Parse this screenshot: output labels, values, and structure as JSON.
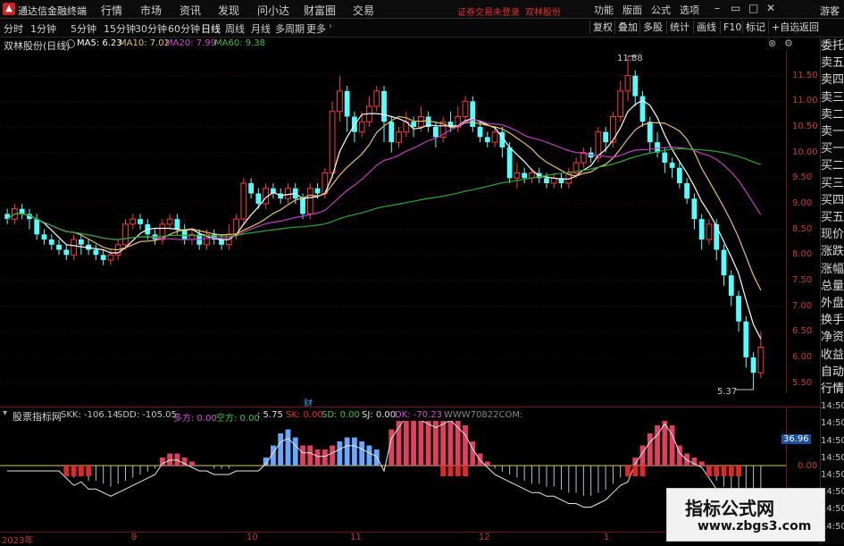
{
  "app": {
    "title": "通达信金融终端",
    "menus": [
      "行情",
      "市场",
      "资讯",
      "发现",
      "问小达",
      "财富圈",
      "交易"
    ],
    "notice": "证券交易未登录",
    "stock_name_top": "双林股份",
    "right_menus": [
      "功能",
      "版面",
      "公式",
      "选项"
    ],
    "guest": "游客"
  },
  "toolbar": {
    "periods": [
      "分时",
      "1分钟",
      "5分钟",
      "15分钟",
      "30分钟",
      "60分钟",
      "日线",
      "周线",
      "月线",
      "多周期",
      "更多"
    ],
    "active_period": "日线",
    "right_buttons": [
      "复权",
      "叠加",
      "多股",
      "统计",
      "画线",
      "F10",
      "标记",
      "+自选",
      "返回"
    ]
  },
  "chart_header": {
    "stock": "双林股份(日线)",
    "ma5": "MA5: 6.23",
    "ma10": "MA10: 7.02",
    "ma20": "MA20: 7.99",
    "ma60": "MA60: 9.38"
  },
  "sidebar": {
    "items": [
      "委托",
      "卖五",
      "卖四",
      "卖三",
      "卖二",
      "卖一",
      "买一",
      "买二",
      "买三",
      "买四",
      "买五",
      "现价",
      "涨跌",
      "涨幅",
      "总量",
      "外盘",
      "换手",
      "净资",
      "收益",
      "自动",
      "行情",
      "14:50",
      "14:50",
      "14:50",
      "14:50",
      "14:50",
      "14:50",
      "14:50",
      "14:50"
    ]
  },
  "indicator": {
    "title": "股票指标网",
    "skk": "SKK: -106.14",
    "sdd": "SDD: -105.05",
    "duofang": "多方: 0.00",
    "kongfang": "空方: 0.00",
    "val575": ": 5.75",
    "sk": "SK: 0.00",
    "sd": "SD: 0.00",
    "sj": "SJ: 0.00",
    "dk": "DK: -70.23",
    "site": "WWW70822COM:",
    "current": "36.96",
    "ticks": [
      "36.96",
      "0.00"
    ]
  },
  "annotations": {
    "high": "11.88",
    "low": "5.37",
    "cai": "财"
  },
  "chart_data": {
    "type": "candlestick",
    "price_ticks": [
      "11.50",
      "11.00",
      "10.50",
      "10.00",
      "9.50",
      "9.00",
      "8.50",
      "8.00",
      "7.50",
      "7.00",
      "6.50",
      "6.00",
      "5.50"
    ],
    "date_labels": [
      "2023年",
      "9",
      "10",
      "11",
      "12",
      "1"
    ],
    "ylim": [
      5.3,
      12.0
    ],
    "candles": [
      [
        8.8,
        8.7,
        8.9,
        8.6
      ],
      [
        8.7,
        8.9,
        9.0,
        8.6
      ],
      [
        8.9,
        8.8,
        9.0,
        8.7
      ],
      [
        8.8,
        8.7,
        8.9,
        8.5
      ],
      [
        8.7,
        8.4,
        8.8,
        8.3
      ],
      [
        8.4,
        8.3,
        8.5,
        8.2
      ],
      [
        8.3,
        8.2,
        8.4,
        8.1
      ],
      [
        8.2,
        8.1,
        8.3,
        8.0
      ],
      [
        8.1,
        8.0,
        8.2,
        7.9
      ],
      [
        8.0,
        8.3,
        8.4,
        7.9
      ],
      [
        8.3,
        8.2,
        8.4,
        8.0
      ],
      [
        8.2,
        8.1,
        8.3,
        8.0
      ],
      [
        8.1,
        8.0,
        8.2,
        7.9
      ],
      [
        8.0,
        7.9,
        8.1,
        7.8
      ],
      [
        7.9,
        8.0,
        8.1,
        7.8
      ],
      [
        8.0,
        8.2,
        8.3,
        7.9
      ],
      [
        8.2,
        8.6,
        8.7,
        8.1
      ],
      [
        8.6,
        8.7,
        8.8,
        8.5
      ],
      [
        8.7,
        8.6,
        8.8,
        8.5
      ],
      [
        8.6,
        8.4,
        8.7,
        8.3
      ],
      [
        8.4,
        8.3,
        8.5,
        8.2
      ],
      [
        8.3,
        8.6,
        8.7,
        8.2
      ],
      [
        8.6,
        8.7,
        8.8,
        8.5
      ],
      [
        8.7,
        8.5,
        8.8,
        8.4
      ],
      [
        8.5,
        8.3,
        8.6,
        8.2
      ],
      [
        8.3,
        8.4,
        8.5,
        8.2
      ],
      [
        8.4,
        8.2,
        8.5,
        8.1
      ],
      [
        8.2,
        8.4,
        8.5,
        8.1
      ],
      [
        8.4,
        8.3,
        8.5,
        8.2
      ],
      [
        8.3,
        8.2,
        8.4,
        8.1
      ],
      [
        8.2,
        8.4,
        8.6,
        8.1
      ],
      [
        8.4,
        8.7,
        8.8,
        8.3
      ],
      [
        8.7,
        9.4,
        9.5,
        8.6
      ],
      [
        9.4,
        9.2,
        9.5,
        9.1
      ],
      [
        9.2,
        9.0,
        9.3,
        8.9
      ],
      [
        9.0,
        9.3,
        9.4,
        8.9
      ],
      [
        9.3,
        9.2,
        9.4,
        9.1
      ],
      [
        9.2,
        9.1,
        9.3,
        9.0
      ],
      [
        9.1,
        9.3,
        9.4,
        9.0
      ],
      [
        9.3,
        9.1,
        9.4,
        9.0
      ],
      [
        9.1,
        8.8,
        9.2,
        8.7
      ],
      [
        8.8,
        9.3,
        9.4,
        8.7
      ],
      [
        9.3,
        9.2,
        9.4,
        9.1
      ],
      [
        9.2,
        9.6,
        9.7,
        9.1
      ],
      [
        9.6,
        10.8,
        11.0,
        9.5
      ],
      [
        10.8,
        11.2,
        11.5,
        10.6
      ],
      [
        11.2,
        10.7,
        11.3,
        10.4
      ],
      [
        10.7,
        10.4,
        10.8,
        10.2
      ],
      [
        10.4,
        10.6,
        10.8,
        10.3
      ],
      [
        10.6,
        10.9,
        11.1,
        10.5
      ],
      [
        10.9,
        11.2,
        11.3,
        10.8
      ],
      [
        11.2,
        10.6,
        11.3,
        10.2
      ],
      [
        10.6,
        10.2,
        10.7,
        10.0
      ],
      [
        10.2,
        10.4,
        10.5,
        10.1
      ],
      [
        10.4,
        10.6,
        10.8,
        10.3
      ],
      [
        10.6,
        10.5,
        10.7,
        10.3
      ],
      [
        10.5,
        10.7,
        10.9,
        10.4
      ],
      [
        10.7,
        10.5,
        10.8,
        10.4
      ],
      [
        10.5,
        10.3,
        10.6,
        10.1
      ],
      [
        10.3,
        10.6,
        10.7,
        10.2
      ],
      [
        10.6,
        10.5,
        10.8,
        10.4
      ],
      [
        10.5,
        10.7,
        10.9,
        10.4
      ],
      [
        10.7,
        11.0,
        11.1,
        10.6
      ],
      [
        11.0,
        10.5,
        11.1,
        10.4
      ],
      [
        10.5,
        10.3,
        10.6,
        10.2
      ],
      [
        10.3,
        10.2,
        10.4,
        10.1
      ],
      [
        10.2,
        10.4,
        10.5,
        10.1
      ],
      [
        10.4,
        10.1,
        10.5,
        9.9
      ],
      [
        10.1,
        9.5,
        10.2,
        9.4
      ],
      [
        9.5,
        9.6,
        9.8,
        9.3
      ],
      [
        9.6,
        9.5,
        9.7,
        9.4
      ],
      [
        9.5,
        9.6,
        9.7,
        9.4
      ],
      [
        9.6,
        9.5,
        9.7,
        9.4
      ],
      [
        9.5,
        9.4,
        9.6,
        9.3
      ],
      [
        9.4,
        9.5,
        9.6,
        9.3
      ],
      [
        9.5,
        9.4,
        9.6,
        9.3
      ],
      [
        9.4,
        9.6,
        9.7,
        9.3
      ],
      [
        9.6,
        9.8,
        9.9,
        9.5
      ],
      [
        9.8,
        10.0,
        10.1,
        9.7
      ],
      [
        10.0,
        9.9,
        10.1,
        9.8
      ],
      [
        9.9,
        10.4,
        10.5,
        9.8
      ],
      [
        10.4,
        10.2,
        10.5,
        10.0
      ],
      [
        10.2,
        10.7,
        10.8,
        10.1
      ],
      [
        10.7,
        11.2,
        11.4,
        10.6
      ],
      [
        11.2,
        11.5,
        11.88,
        11.0
      ],
      [
        11.5,
        11.1,
        11.6,
        10.9
      ],
      [
        11.1,
        10.6,
        11.2,
        10.5
      ],
      [
        10.6,
        10.2,
        10.7,
        10.0
      ],
      [
        10.2,
        10.0,
        10.4,
        9.9
      ],
      [
        10.0,
        9.8,
        10.1,
        9.6
      ],
      [
        9.8,
        9.7,
        9.9,
        9.5
      ],
      [
        9.7,
        9.4,
        9.8,
        9.3
      ],
      [
        9.4,
        9.1,
        9.5,
        9.0
      ],
      [
        9.1,
        8.7,
        9.2,
        8.5
      ],
      [
        8.7,
        8.3,
        8.8,
        8.1
      ],
      [
        8.3,
        8.6,
        8.7,
        8.2
      ],
      [
        8.6,
        8.1,
        8.7,
        7.9
      ],
      [
        8.1,
        7.6,
        8.2,
        7.4
      ],
      [
        7.6,
        7.2,
        7.7,
        7.0
      ],
      [
        7.2,
        6.7,
        7.3,
        6.5
      ],
      [
        6.7,
        6.0,
        6.8,
        5.8
      ],
      [
        6.0,
        5.7,
        6.1,
        5.37
      ],
      [
        5.7,
        6.2,
        6.5,
        5.6
      ]
    ],
    "ma_series": [
      {
        "name": "MA5",
        "color": "#ffffff"
      },
      {
        "name": "MA10",
        "color": "#e6c36a"
      },
      {
        "name": "MA20",
        "color": "#c040c0"
      },
      {
        "name": "MA60",
        "color": "#2ea82e"
      }
    ],
    "indicator_bars": [
      0,
      0,
      0,
      0,
      0,
      0,
      0,
      0,
      -0.2,
      -0.4,
      -0.3,
      -0.5,
      -0.5,
      -0.6,
      -0.7,
      -0.6,
      -0.5,
      -0.4,
      -0.3,
      -0.2,
      -0.1,
      0.2,
      0.3,
      0.3,
      0.2,
      0.1,
      0,
      0,
      -0.1,
      -0.1,
      -0.1,
      0,
      0,
      0,
      0,
      0.2,
      0.5,
      0.8,
      0.9,
      0.7,
      0.5,
      0.5,
      0.4,
      0.4,
      0.5,
      0.6,
      0.7,
      0.7,
      0.6,
      0.5,
      0.4,
      0,
      0.9,
      1.2,
      1.5,
      1.5,
      1.4,
      1.3,
      1.2,
      1.3,
      1.4,
      1.2,
      1.0,
      0.6,
      0.3,
      0.1,
      -0.1,
      -0.2,
      -0.3,
      -0.4,
      -0.5,
      -0.6,
      -0.6,
      -0.7,
      -0.7,
      -0.8,
      -0.9,
      -0.9,
      -1.0,
      -1.0,
      -0.9,
      -0.8,
      -0.6,
      -0.4,
      -0.3,
      0.2,
      0.5,
      0.8,
      1.0,
      1.3,
      1.0,
      0.5,
      0.3,
      0.2,
      0.1,
      -0.2,
      -0.5,
      -0.7,
      -1.0,
      -1.0,
      -1.0,
      -1.0,
      -1.0
    ]
  }
}
